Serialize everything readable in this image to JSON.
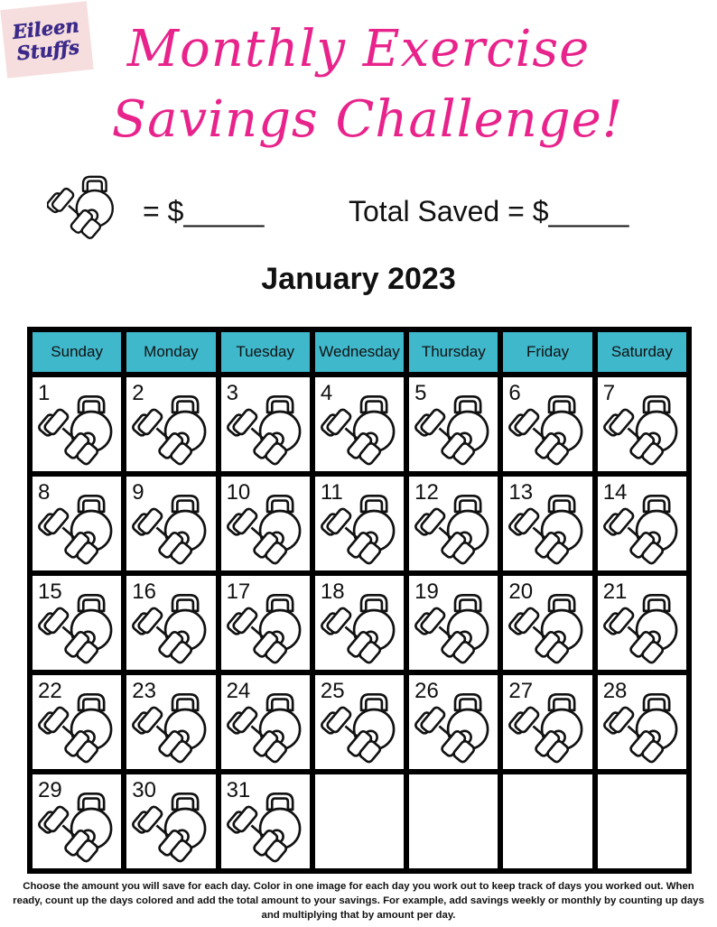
{
  "logo": {
    "line1": "Eileen",
    "line2": "Stuffs"
  },
  "title": {
    "line1": "Monthly Exercise",
    "line2": "Savings Challenge!"
  },
  "rate": {
    "per_workout": "= $_____",
    "total": "Total Saved = $_____"
  },
  "month": "January 2023",
  "weekdays": [
    "Sunday",
    "Monday",
    "Tuesday",
    "Wednesday",
    "Thursday",
    "Friday",
    "Saturday"
  ],
  "days": [
    "1",
    "2",
    "3",
    "4",
    "5",
    "6",
    "7",
    "8",
    "9",
    "10",
    "11",
    "12",
    "13",
    "14",
    "15",
    "16",
    "17",
    "18",
    "19",
    "20",
    "21",
    "22",
    "23",
    "24",
    "25",
    "26",
    "27",
    "28",
    "29",
    "30",
    "31"
  ],
  "instructions": "Choose the amount you will save for each day. Color in one image for each day you work out to keep track of days you worked out. When ready, count up the days colored and add the total amount to your savings. For example, add savings weekly or monthly by counting up days and multiplying that by amount per day.",
  "icon": "kettlebell-dumbbell-icon",
  "colors": {
    "title": "#e8238b",
    "header": "#3fb8cb",
    "logo_text": "#3b2a8a",
    "logo_bg": "#f7dede"
  }
}
